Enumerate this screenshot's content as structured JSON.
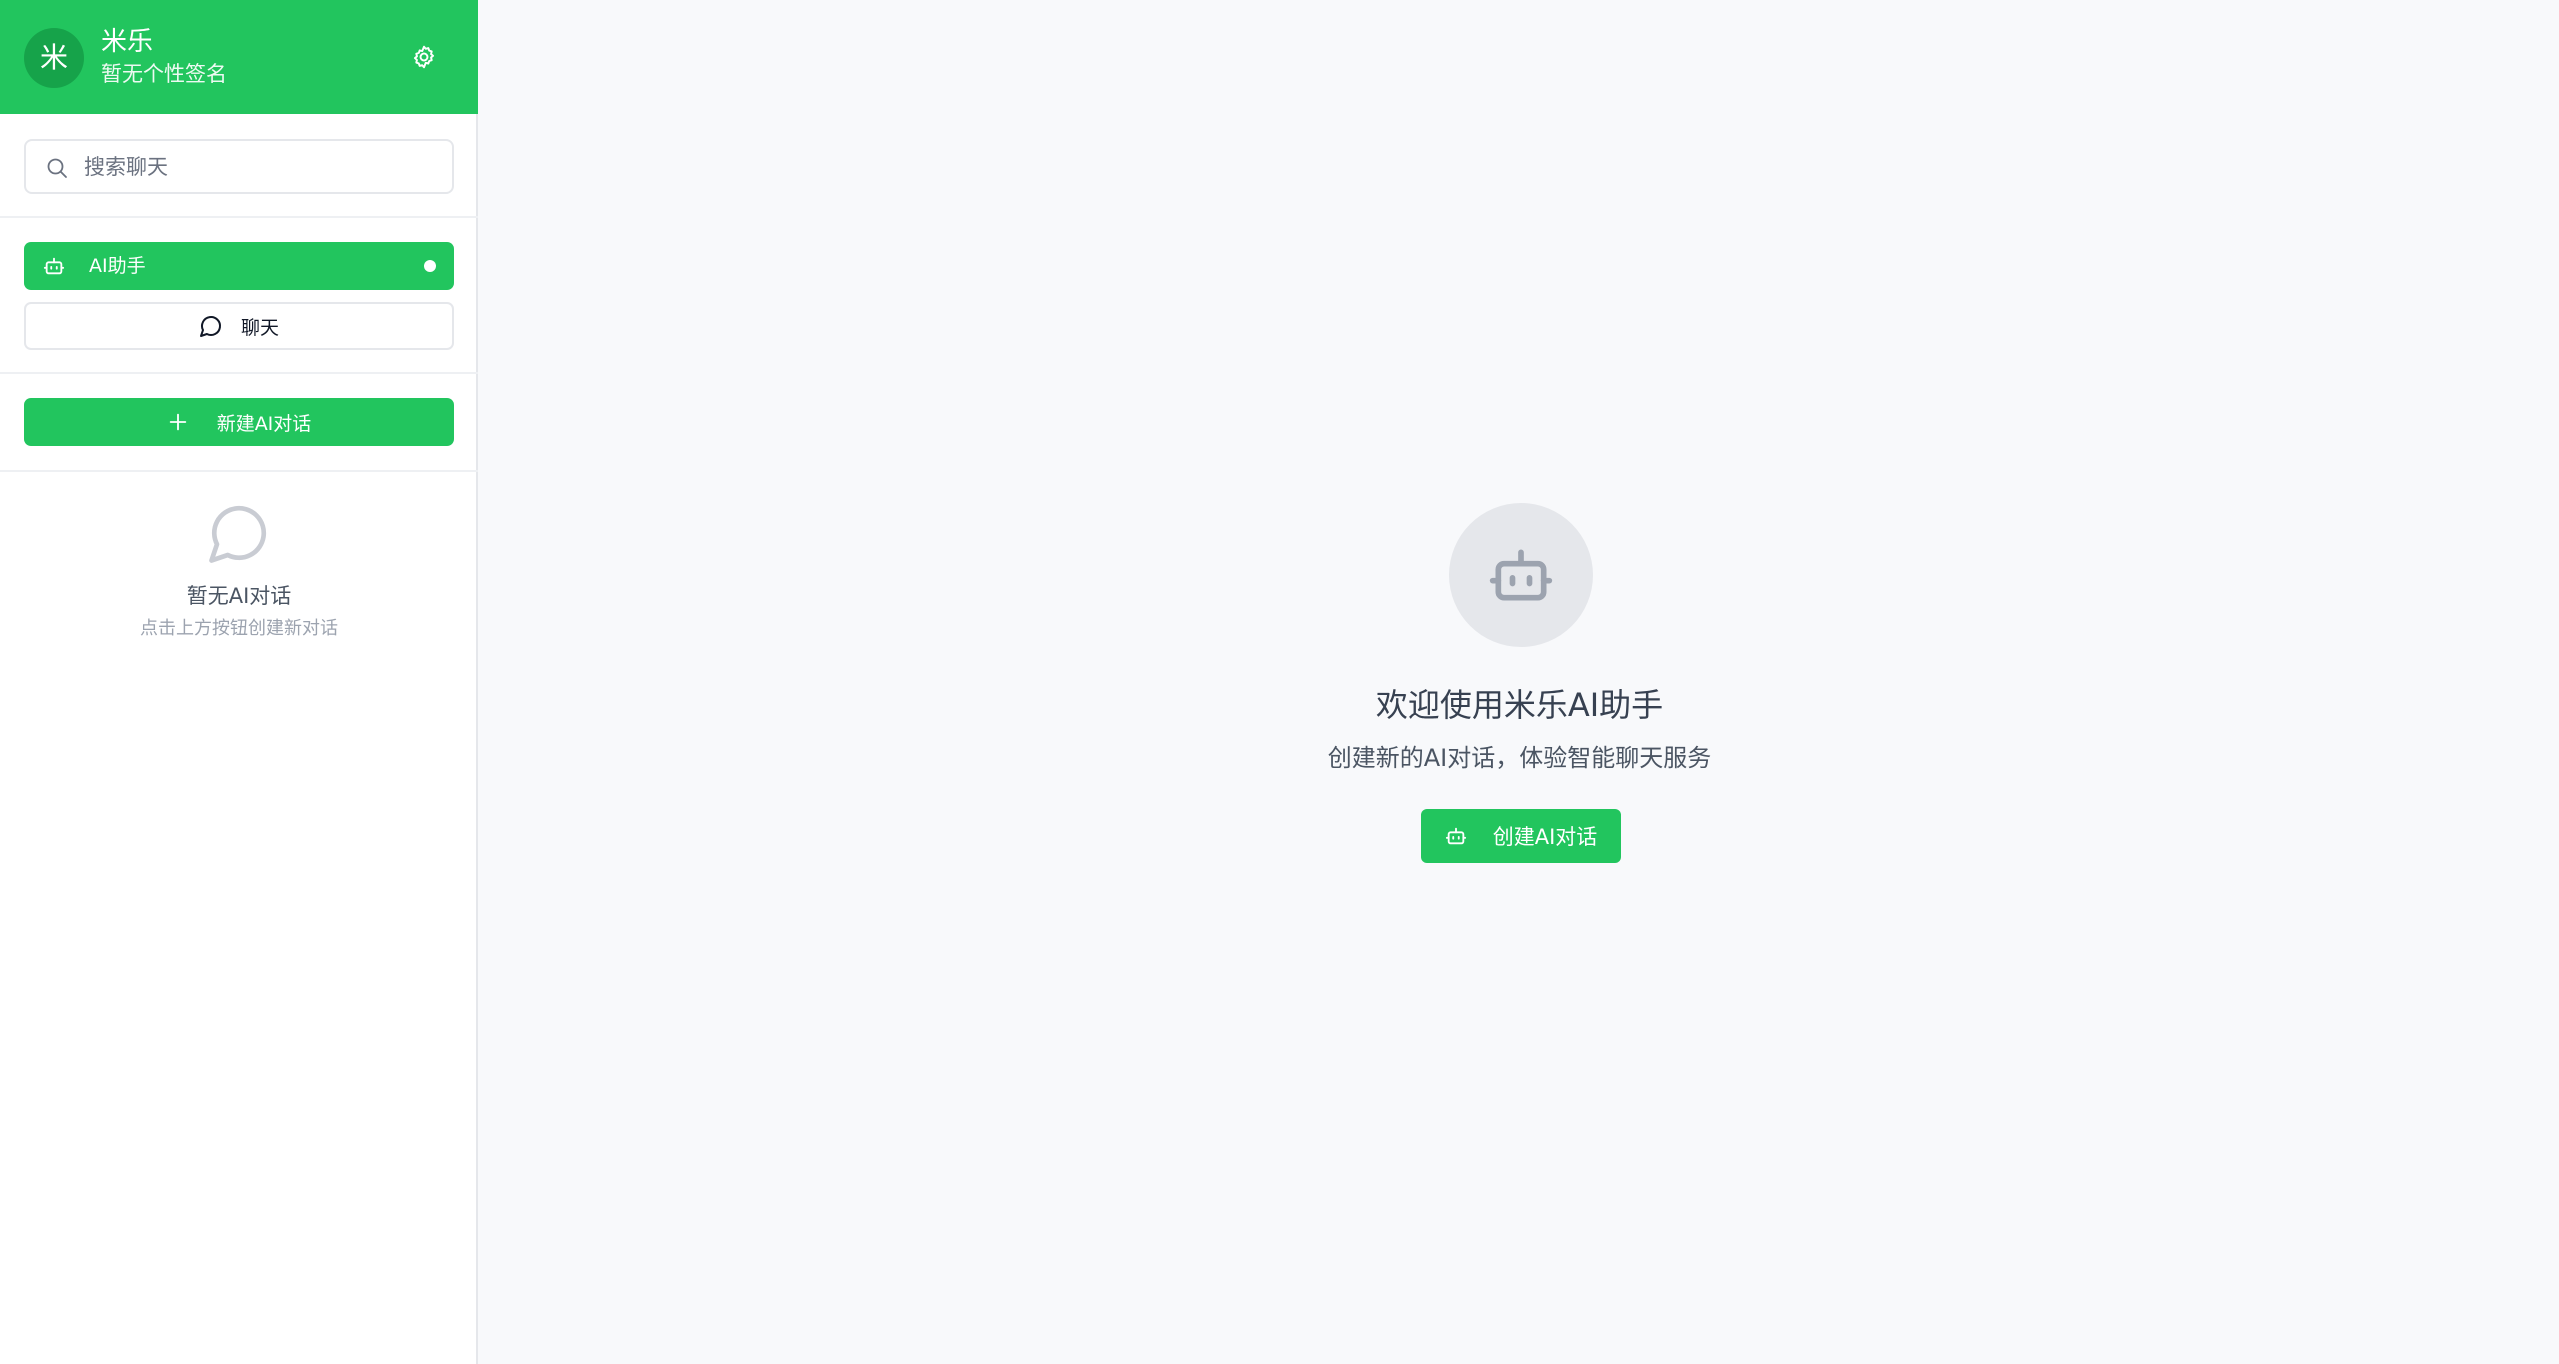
{
  "profile": {
    "avatar_text": "米",
    "name": "米乐",
    "signature": "暂无个性签名",
    "settings_icon": "gear-icon"
  },
  "search": {
    "placeholder": "搜索聊天",
    "value": "",
    "icon": "search-icon"
  },
  "tabs": [
    {
      "label": "AI助手",
      "icon": "robot-icon",
      "active": true
    },
    {
      "label": "聊天",
      "icon": "chat-bubble-icon",
      "active": false
    }
  ],
  "new_ai_button": {
    "label": "新建AI对话",
    "icon": "plus-icon"
  },
  "empty_list": {
    "icon": "chat-bubble-icon",
    "title": "暂无AI对话",
    "hint": "点击上方按钮创建新对话"
  },
  "welcome": {
    "icon": "robot-icon",
    "title": "欢迎使用米乐AI助手",
    "subtitle": "创建新的AI对话，体验智能聊天服务",
    "button_label": "创建AI对话",
    "button_icon": "robot-icon"
  },
  "colors": {
    "brand_green": "#22c55e",
    "avatar_green": "#16a34a",
    "main_background": "#f8f9fb",
    "icon_gray": "#9ca3af"
  }
}
